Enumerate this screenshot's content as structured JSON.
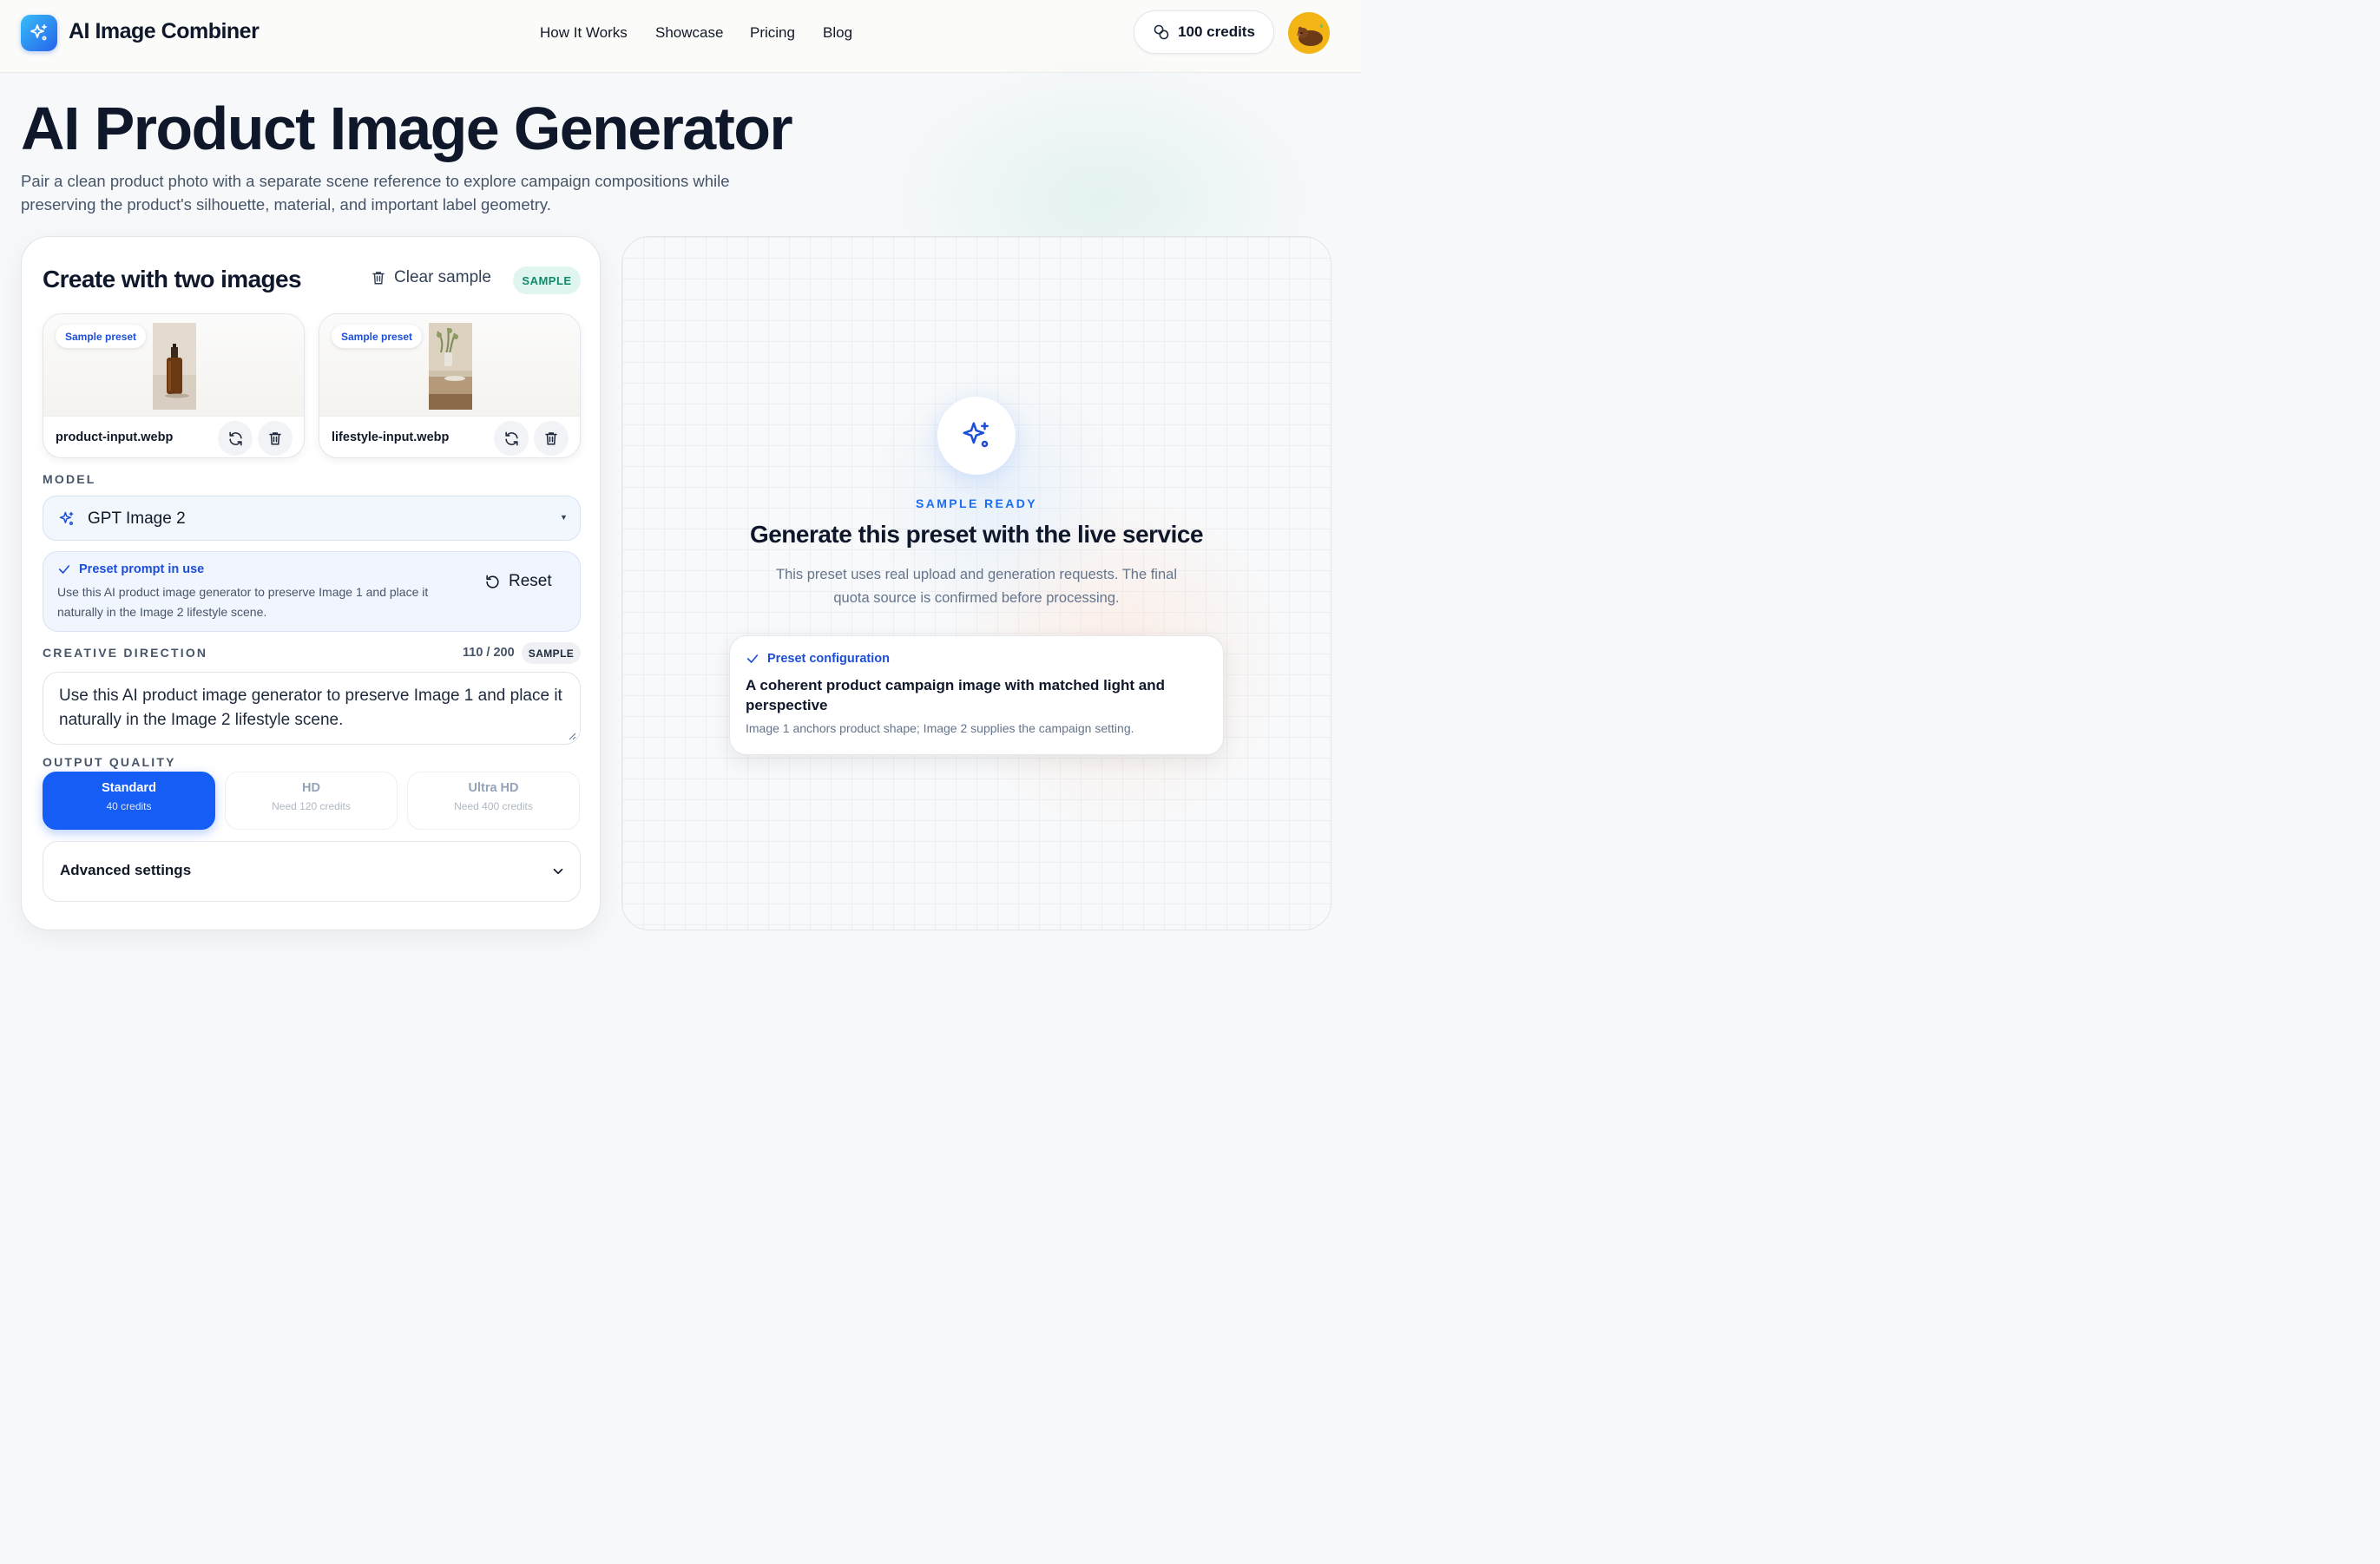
{
  "header": {
    "brand": "AI Image Combiner",
    "nav": [
      "How It Works",
      "Showcase",
      "Pricing",
      "Blog"
    ],
    "credits": "100 credits",
    "icons": {
      "logo": "sparkle-icon",
      "credits": "coins-icon",
      "avatar": "bear-avatar"
    }
  },
  "hero": {
    "title": "AI Product Image Generator",
    "subtitle": "Pair a clean product photo with a separate scene reference to explore campaign compositions while preserving the product's silhouette, material, and important label geometry."
  },
  "creator": {
    "title": "Create with two images",
    "clear_label": "Clear sample",
    "sample_badge": "SAMPLE",
    "uploads": [
      {
        "tag": "Sample preset",
        "file": "product-input.webp"
      },
      {
        "tag": "Sample preset",
        "file": "lifestyle-input.webp"
      }
    ],
    "model": {
      "label": "MODEL",
      "value": "GPT Image 2"
    },
    "preset_prompt": {
      "title": "Preset prompt in use",
      "text": "Use this AI product image generator to preserve Image 1 and place it naturally in the Image 2 lifestyle scene.",
      "reset_label": "Reset"
    },
    "creative_direction": {
      "label": "CREATIVE DIRECTION",
      "counter": "110 / 200",
      "badge": "SAMPLE",
      "value": "Use this AI product image generator to preserve Image 1 and place it naturally in the Image 2 lifestyle scene."
    },
    "output_quality": {
      "label": "OUTPUT QUALITY",
      "selected": "Standard",
      "options": [
        {
          "name": "Standard",
          "sub": "40 credits"
        },
        {
          "name": "HD",
          "sub": "Need 120 credits"
        },
        {
          "name": "Ultra HD",
          "sub": "Need 400 credits"
        }
      ]
    },
    "advanced_label": "Advanced settings"
  },
  "preview": {
    "status": "SAMPLE READY",
    "title": "Generate this preset with the live service",
    "description": "This preset uses real upload and generation requests. The final quota source is confirmed before processing.",
    "config": {
      "head": "Preset configuration",
      "title": "A coherent product campaign image with matched light and perspective",
      "note": "Image 1 anchors product shape; Image 2 supplies the campaign setting."
    }
  },
  "colors": {
    "accent": "#155df4",
    "teal": "#0f8a6c",
    "logo_gradient_start": "#38bdf8",
    "logo_gradient_end": "#2563eb"
  }
}
